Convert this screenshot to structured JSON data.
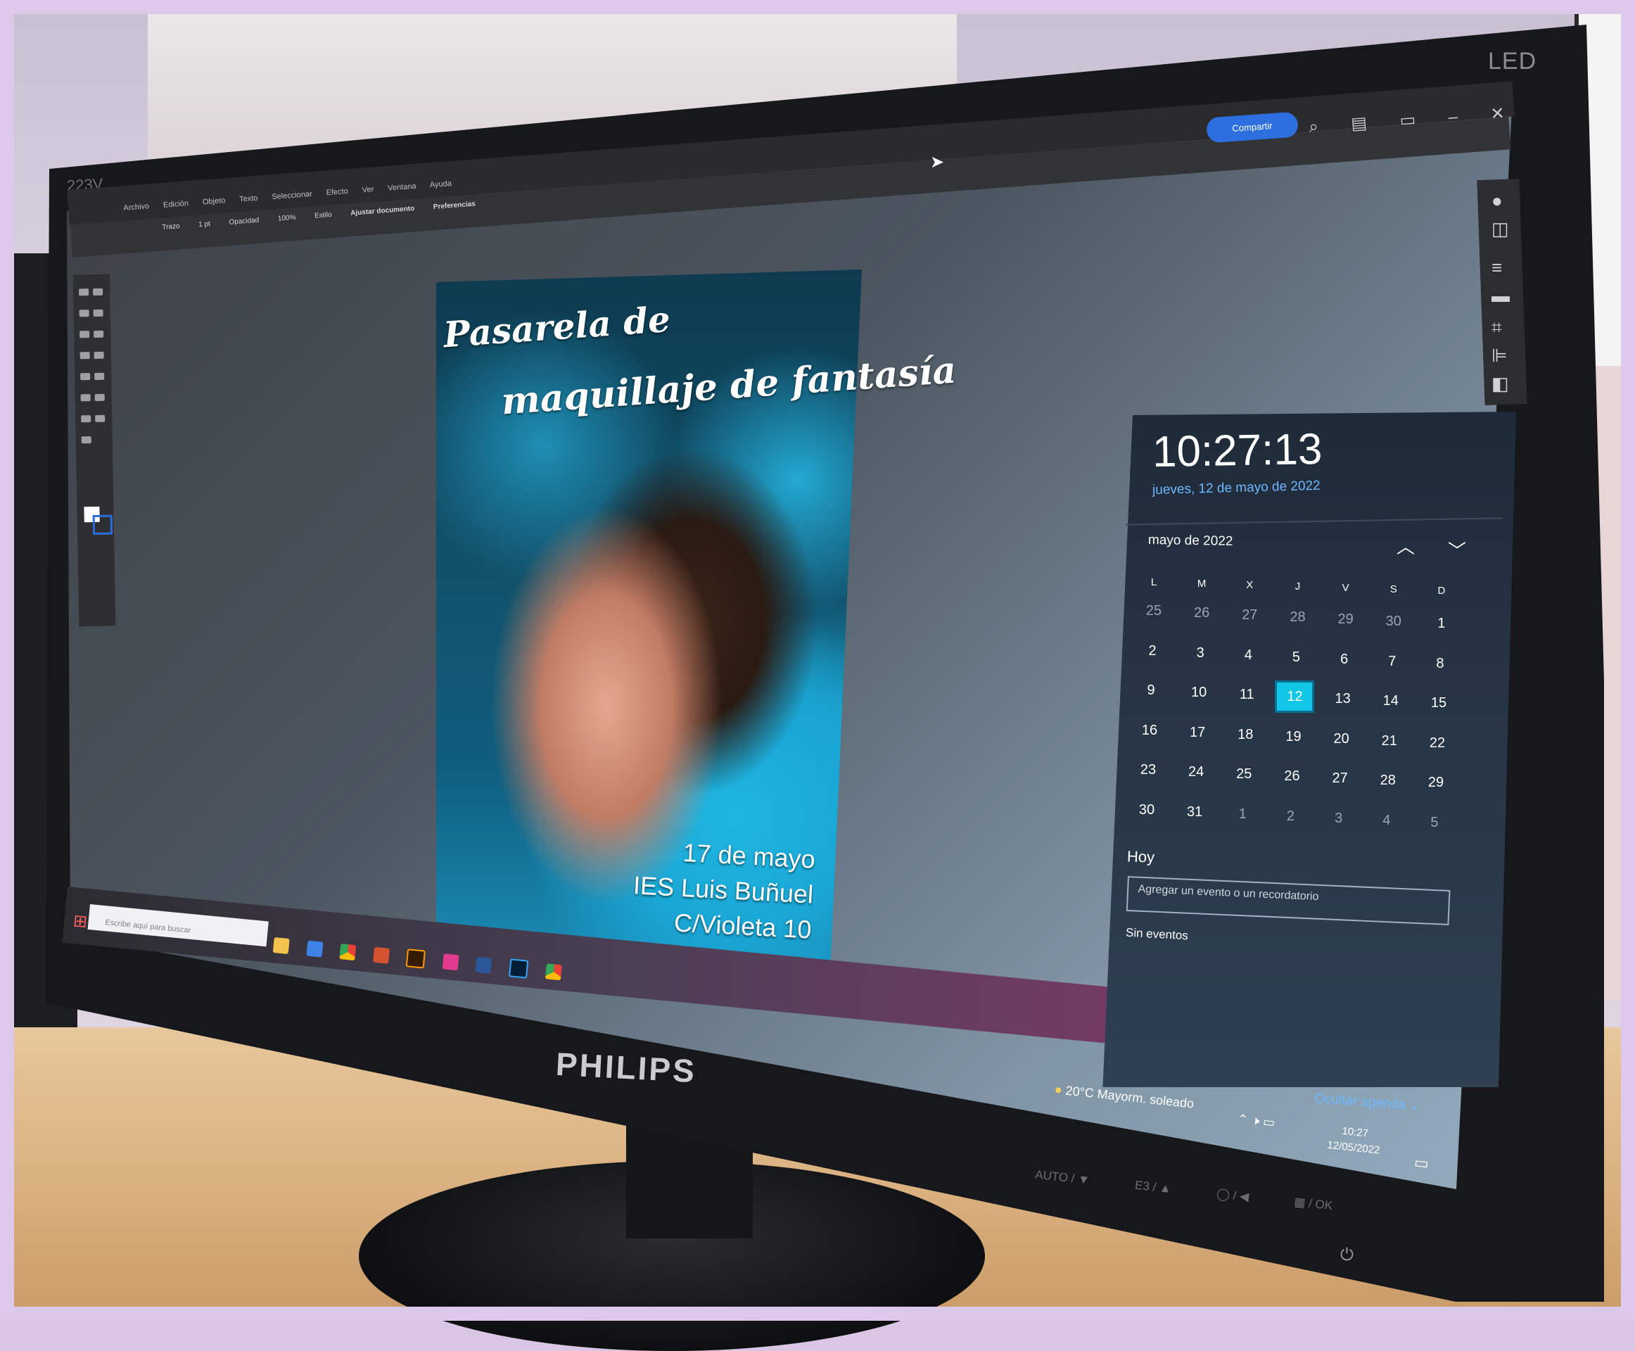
{
  "monitor": {
    "brand": "PHILIPS",
    "panel_type": "LED",
    "model": "223V",
    "buttons": [
      "AUTO / ▼",
      "E3 / ▲",
      "◯ / ◀",
      "▦ / OK"
    ]
  },
  "illustrator": {
    "menus": [
      "Archivo",
      "Edición",
      "Objeto",
      "Texto",
      "Seleccionar",
      "Efecto",
      "Ver",
      "Ventana",
      "Ayuda"
    ],
    "control_bar": {
      "trazo_label": "Trazo",
      "trazo_value": "1 pt",
      "opacity_label": "Opacidad",
      "opacity_value": "100%",
      "style_label": "Estilo",
      "fit_document": "Ajustar documento",
      "preferences": "Preferencias"
    },
    "share_button": "Compartir"
  },
  "poster": {
    "title_line1": "Pasarela de",
    "title_line2": "maquillaje de fantasía",
    "date": "17 de mayo",
    "venue": "IES Luis Buñuel",
    "address": "C/Violeta 10"
  },
  "calendar_flyout": {
    "time": "10:27:13",
    "full_date": "jueves, 12 de mayo de 2022",
    "month": "mayo de 2022",
    "weekdays": [
      "L",
      "M",
      "X",
      "J",
      "V",
      "S",
      "D"
    ],
    "weeks": [
      [
        "25",
        "26",
        "27",
        "28",
        "29",
        "30",
        "1"
      ],
      [
        "2",
        "3",
        "4",
        "5",
        "6",
        "7",
        "8"
      ],
      [
        "9",
        "10",
        "11",
        "12",
        "13",
        "14",
        "15"
      ],
      [
        "16",
        "17",
        "18",
        "19",
        "20",
        "21",
        "22"
      ],
      [
        "23",
        "24",
        "25",
        "26",
        "27",
        "28",
        "29"
      ],
      [
        "30",
        "31",
        "1",
        "2",
        "3",
        "4",
        "5"
      ]
    ],
    "today": "12",
    "today_label": "Hoy",
    "event_placeholder": "Agregar un evento o un recordatorio",
    "no_events": "Sin eventos",
    "hide_agenda": "Ocultar agenda"
  },
  "taskbar": {
    "search_placeholder": "Escribe aquí para buscar",
    "weather": "20°C  Mayorm. soleado",
    "clock_time": "10:27",
    "clock_date": "12/05/2022"
  }
}
